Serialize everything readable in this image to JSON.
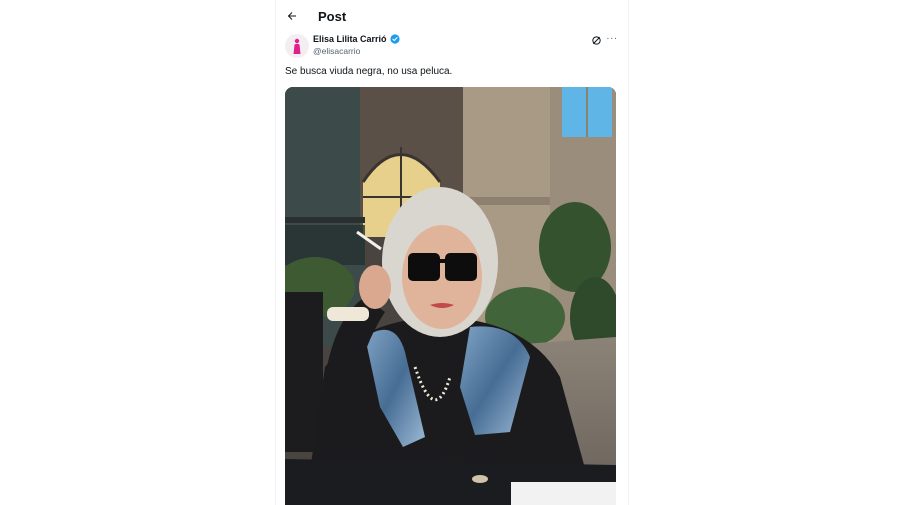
{
  "header": {
    "back_icon": "arrow-left-icon",
    "title": "Post"
  },
  "post": {
    "author_name": "Elisa Lilita Carrió",
    "verified_icon": "verified-badge-icon",
    "handle": "@elisacarrio",
    "text": "Se busca viuda negra, no usa peluca.",
    "actions": {
      "grok_icon": "grok-icon",
      "more_icon": "more-options-icon",
      "more_label": "···"
    },
    "media": {
      "type": "photo",
      "icon": "photo"
    }
  },
  "colors": {
    "text": "#0f1419",
    "secondary": "#536471",
    "verified": "#1d9bf0",
    "avatar_figure": "#e0218a"
  }
}
